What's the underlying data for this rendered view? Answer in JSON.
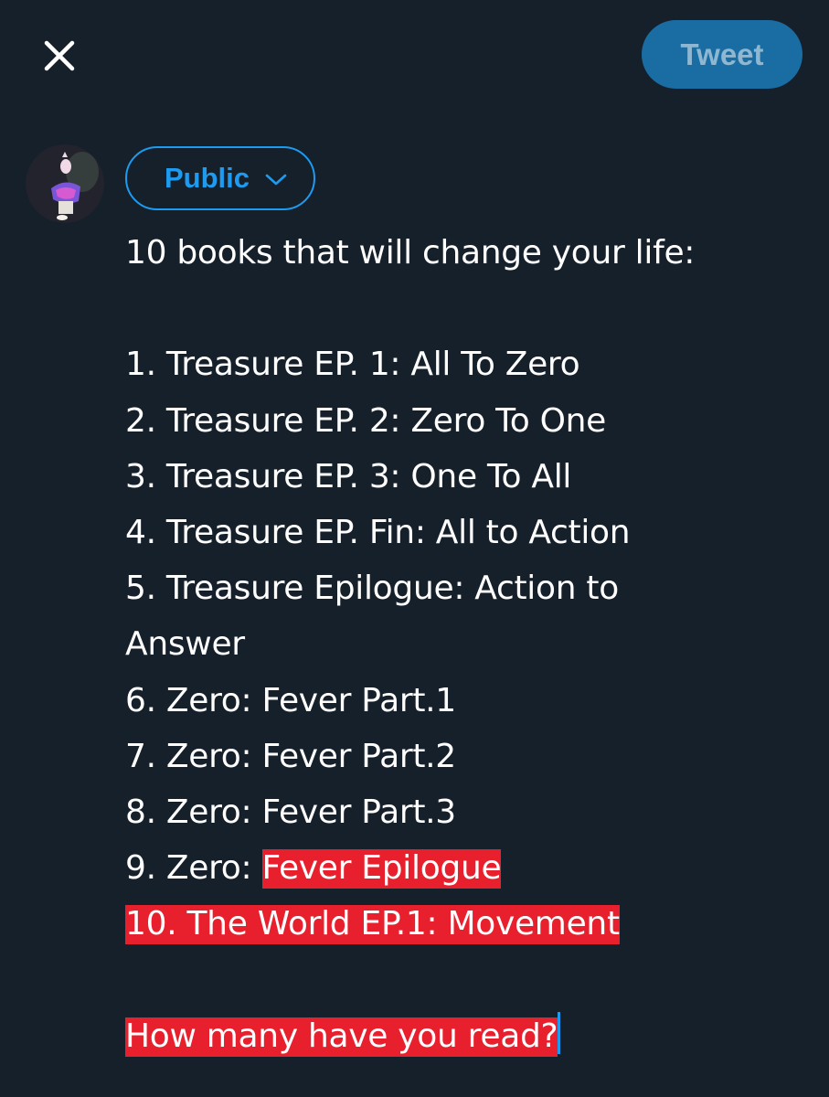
{
  "header": {
    "close_icon": "close-icon",
    "tweet_label": "Tweet"
  },
  "composer": {
    "avatar_icon": "avatar-image",
    "audience_label": "Public",
    "audience_icon": "chevron-down-icon",
    "lines": {
      "intro": "10 books that will change your life:",
      "item1": "1. Treasure EP. 1: All To Zero",
      "item2": "2. Treasure EP. 2: Zero To One",
      "item3": "3. Treasure EP. 3: One To All",
      "item4": "4. Treasure EP. Fin: All to Action",
      "item5a": "5. Treasure Epilogue: Action to",
      "item5b": "Answer",
      "item6": "6. Zero: Fever Part.1",
      "item7": "7. Zero: Fever Part.2",
      "item8": "8. Zero: Fever Part.3",
      "item9_plain": "9. Zero: ",
      "item9_highlight": "Fever Epilogue",
      "item10": "10. The World EP.1: Movement",
      "question": "How many have you read?"
    },
    "selection_color": "#e8202d",
    "accent_color": "#1d9bf0"
  }
}
